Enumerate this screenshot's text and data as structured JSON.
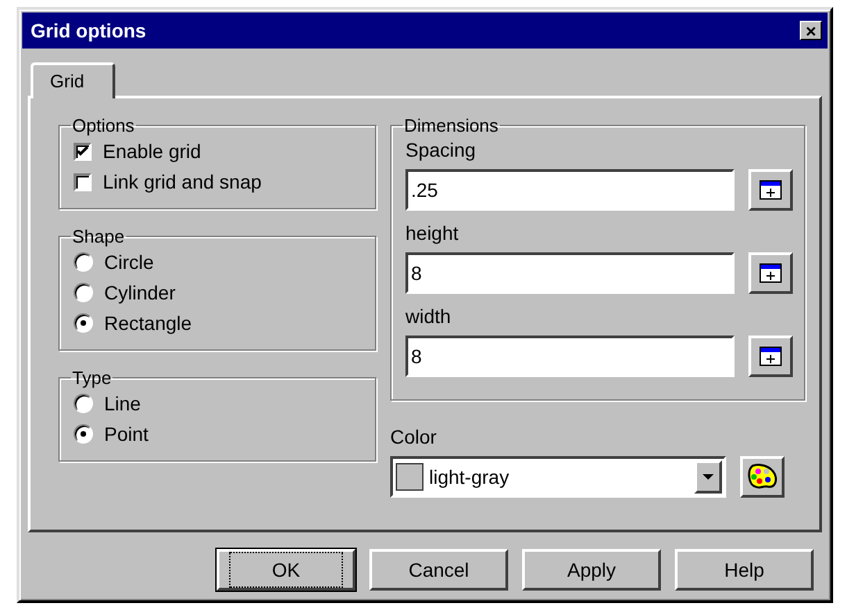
{
  "window": {
    "title": "Grid options",
    "close": "×"
  },
  "tabs": [
    {
      "label": "Grid",
      "selected": true
    }
  ],
  "options": {
    "title": "Options",
    "items": [
      {
        "label": "Enable grid",
        "checked": true
      },
      {
        "label": "Link grid and snap",
        "checked": false
      }
    ]
  },
  "shape": {
    "title": "Shape",
    "items": [
      {
        "label": "Circle",
        "selected": false
      },
      {
        "label": "Cylinder",
        "selected": false
      },
      {
        "label": "Rectangle",
        "selected": true
      }
    ]
  },
  "type": {
    "title": "Type",
    "items": [
      {
        "label": "Line",
        "selected": false
      },
      {
        "label": "Point",
        "selected": true
      }
    ]
  },
  "dimensions": {
    "title": "Dimensions",
    "fields": [
      {
        "label": "Spacing",
        "value": ".25"
      },
      {
        "label": "height",
        "value": "8"
      },
      {
        "label": "width",
        "value": "8"
      }
    ]
  },
  "color": {
    "label": "Color",
    "value": "light-gray"
  },
  "buttons": [
    {
      "label": "OK",
      "default": true
    },
    {
      "label": "Cancel",
      "default": false
    },
    {
      "label": "Apply",
      "default": false
    },
    {
      "label": "Help",
      "default": false
    }
  ]
}
